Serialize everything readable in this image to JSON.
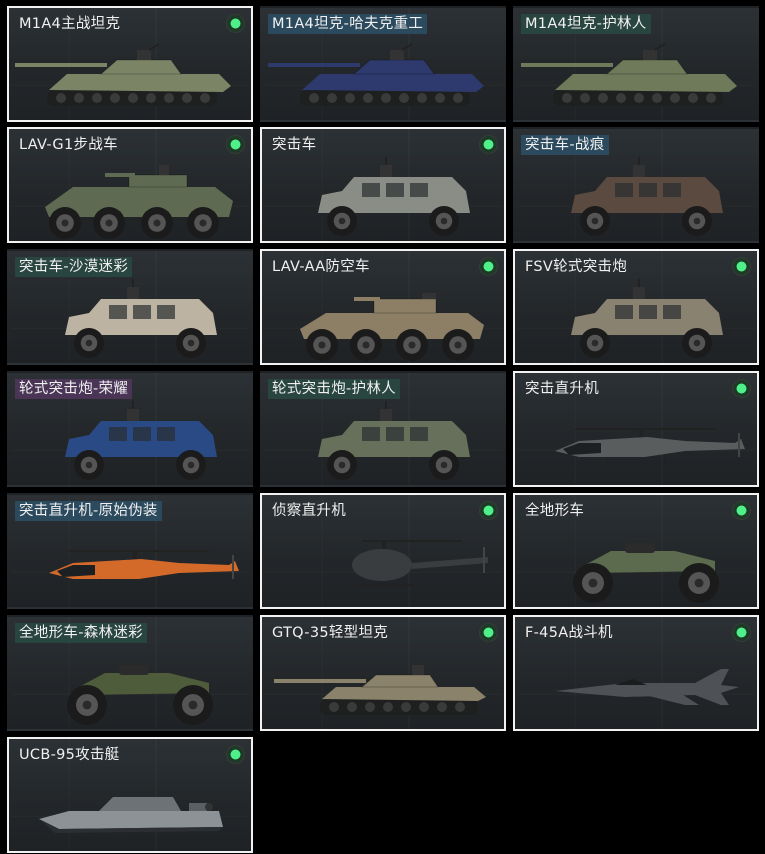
{
  "cards": [
    {
      "name": "M1A4主战坦克",
      "tag": "none",
      "owned": true,
      "badge": true,
      "icon": "tank-icon",
      "camo": "#7c8466"
    },
    {
      "name": "M1A4坦克-哈夫克重工",
      "tag": "blue",
      "owned": false,
      "badge": false,
      "icon": "tank-icon",
      "camo": "#2e3a6e"
    },
    {
      "name": "M1A4坦克-护林人",
      "tag": "teal",
      "owned": false,
      "badge": false,
      "icon": "tank-icon",
      "camo": "#6f7a5a"
    },
    {
      "name": "LAV-G1步战车",
      "tag": "none",
      "owned": true,
      "badge": true,
      "icon": "ifv-icon",
      "camo": "#5e6b52"
    },
    {
      "name": "突击车",
      "tag": "none",
      "owned": true,
      "badge": true,
      "icon": "armored-car-icon",
      "camo": "#8a8c86"
    },
    {
      "name": "突击车-战痕",
      "tag": "blue",
      "owned": false,
      "badge": false,
      "icon": "armored-car-icon",
      "camo": "#5a4a40"
    },
    {
      "name": "突击车-沙漠迷彩",
      "tag": "teal",
      "owned": false,
      "badge": false,
      "icon": "armored-car-icon",
      "camo": "#bdb3a3"
    },
    {
      "name": "LAV-AA防空车",
      "tag": "none",
      "owned": true,
      "badge": true,
      "icon": "aa-vehicle-icon",
      "camo": "#8c7f66"
    },
    {
      "name": "FSV轮式突击炮",
      "tag": "none",
      "owned": true,
      "badge": true,
      "icon": "armored-car-icon",
      "camo": "#8a8270"
    },
    {
      "name": "轮式突击炮-荣耀",
      "tag": "purple",
      "owned": false,
      "badge": false,
      "icon": "armored-car-icon",
      "camo": "#2a4a86"
    },
    {
      "name": "轮式突击炮-护林人",
      "tag": "teal",
      "owned": false,
      "badge": false,
      "icon": "armored-car-icon",
      "camo": "#66705a"
    },
    {
      "name": "突击直升机",
      "tag": "none",
      "owned": true,
      "badge": true,
      "icon": "attack-helicopter-icon",
      "camo": "#5a5d5e"
    },
    {
      "name": "突击直升机-原始伪装",
      "tag": "blue",
      "owned": false,
      "badge": false,
      "icon": "attack-helicopter-icon",
      "camo": "#d46a2a"
    },
    {
      "name": "侦察直升机",
      "tag": "none",
      "owned": true,
      "badge": true,
      "icon": "scout-helicopter-icon",
      "camo": "#3a3d40"
    },
    {
      "name": "全地形车",
      "tag": "none",
      "owned": true,
      "badge": true,
      "icon": "atv-icon",
      "camo": "#5c6b4e"
    },
    {
      "name": "全地形车-森林迷彩",
      "tag": "teal",
      "owned": false,
      "badge": false,
      "icon": "atv-icon",
      "camo": "#4e5c3c"
    },
    {
      "name": "GTQ-35轻型坦克",
      "tag": "none",
      "owned": true,
      "badge": true,
      "icon": "light-tank-icon",
      "camo": "#8a826a"
    },
    {
      "name": "F-45A战斗机",
      "tag": "none",
      "owned": true,
      "badge": true,
      "icon": "fighter-jet-icon",
      "camo": "#4e5256"
    },
    {
      "name": "UCB-95攻击艇",
      "tag": "none",
      "owned": true,
      "badge": true,
      "icon": "attack-boat-icon",
      "camo": "#8c9296"
    }
  ]
}
